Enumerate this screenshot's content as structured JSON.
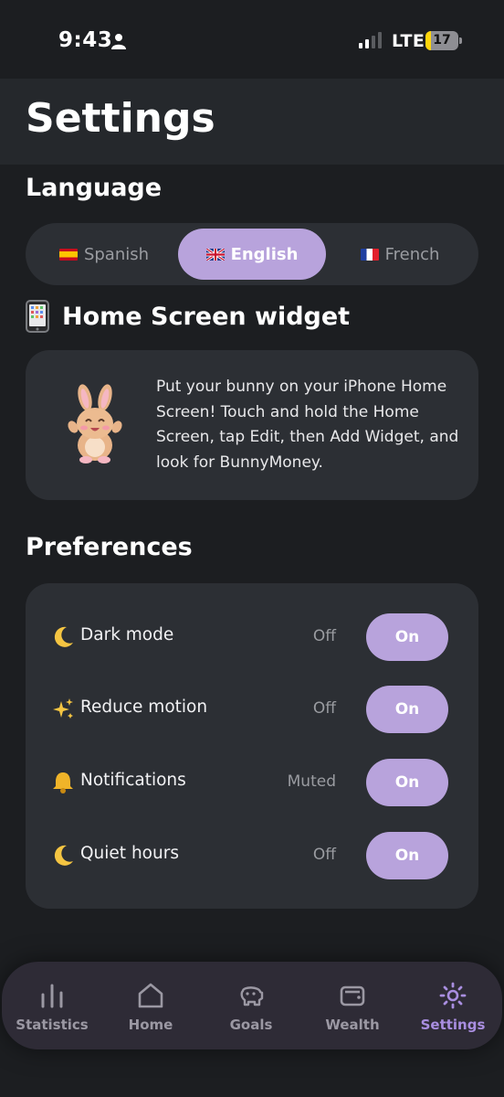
{
  "status_bar": {
    "time": "9:43",
    "network": "LTE",
    "battery": "17",
    "battery_level": 0.17,
    "battery_color": "#ffd60a"
  },
  "header": {
    "title": "Settings"
  },
  "language": {
    "title": "Language",
    "options": [
      {
        "label": "Spanish",
        "flag": "spain-flag-icon",
        "selected": false
      },
      {
        "label": "English",
        "flag": "uk-flag-icon",
        "selected": true
      },
      {
        "label": "French",
        "flag": "france-flag-icon",
        "selected": false
      }
    ]
  },
  "widget": {
    "icon": "mobile-phone-icon",
    "title": "Home Screen widget",
    "mascot": "bunny-icon",
    "description": "Put your bunny on your iPhone Home Screen! Touch and hold the Home Screen, tap Edit, then Add Widget, and look for BunnyMoney."
  },
  "preferences": {
    "title": "Preferences",
    "items": [
      {
        "icon": "crescent-moon-icon",
        "label": "Dark mode",
        "state": "Off",
        "toggle": "On"
      },
      {
        "icon": "sparkles-icon",
        "label": "Reduce motion",
        "state": "Off",
        "toggle": "On"
      },
      {
        "icon": "bell-icon",
        "label": "Notifications",
        "state": "Muted",
        "toggle": "On"
      },
      {
        "icon": "crescent-moon-icon",
        "label": "Quiet hours",
        "state": "Off",
        "toggle": "On"
      }
    ]
  },
  "tab_bar": {
    "tabs": [
      {
        "label": "Statistics",
        "icon": "bar-chart-icon",
        "active": false
      },
      {
        "label": "Home",
        "icon": "house-icon",
        "active": false
      },
      {
        "label": "Goals",
        "icon": "piggy-bank-icon",
        "active": false
      },
      {
        "label": "Wealth",
        "icon": "wallet-icon",
        "active": false
      },
      {
        "label": "Settings",
        "icon": "gear-icon",
        "active": true
      }
    ]
  },
  "colors": {
    "background": "#1c1e21",
    "card": "#2c2f34",
    "accent": "#b8a3dc",
    "tab_active": "#a98ee0"
  }
}
